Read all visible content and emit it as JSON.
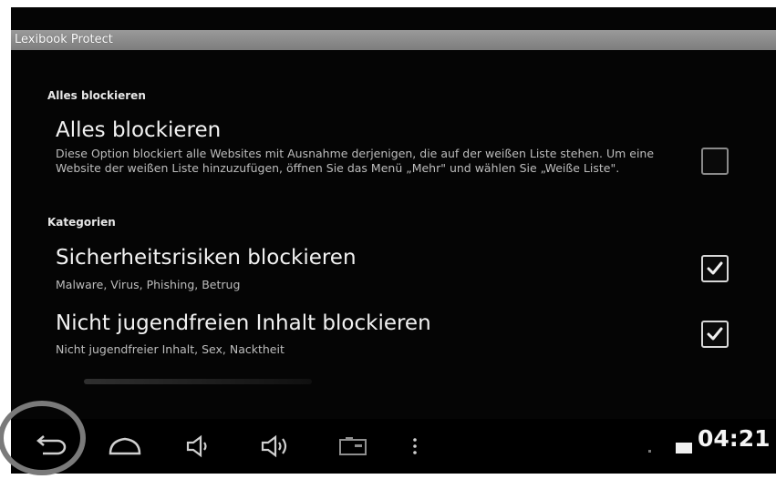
{
  "app": {
    "title": "Lexibook Protect"
  },
  "sections": [
    {
      "header": "Alles blockieren",
      "items": [
        {
          "title": "Alles blockieren",
          "summary": "Diese Option blockiert alle Websites mit Ausnahme derjenigen, die auf der weißen Liste stehen. Um eine Website der weißen Liste hinzuzufügen, öffnen Sie das Menü „Mehr\" und wählen Sie „Weiße Liste\".",
          "checked": false
        }
      ]
    },
    {
      "header": "Kategorien",
      "items": [
        {
          "title": "Sicherheitsrisiken blockieren",
          "summary": "Malware, Virus, Phishing, Betrug",
          "checked": true
        },
        {
          "title": "Nicht jugendfreien Inhalt blockieren",
          "summary": "Nicht jugendfreier Inhalt, Sex, Nacktheit",
          "checked": true
        }
      ]
    }
  ],
  "status_bar": {
    "time": "04:21"
  },
  "nav_icons": [
    "back-icon",
    "home-icon",
    "volume-down-icon",
    "volume-up-icon",
    "screenshot-icon",
    "menu-icon"
  ],
  "colors": {
    "title_bar": "#8a8a8a",
    "background": "#050505",
    "highlight_ring": "#7a7a7a"
  }
}
